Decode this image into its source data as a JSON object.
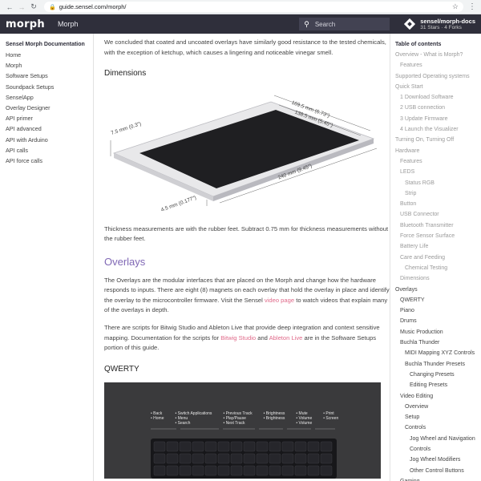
{
  "browser": {
    "back": "←",
    "forward": "→",
    "reload": "↻",
    "url": "guide.sensel.com/morph/",
    "star": "☆",
    "menu": "⋮"
  },
  "topnav": {
    "logo": "morph",
    "brand": "Morph",
    "search_placeholder": "Search",
    "repo_name": "sensel/morph-docs",
    "repo_stats": "31 Stars · 4 Forks"
  },
  "sidebar": {
    "title": "Sensel Morph Documentation",
    "items": [
      "Home",
      "Morph",
      "Software Setups",
      "Soundpack Setups",
      "SenselApp",
      "Overlay Designer",
      "API primer",
      "API advanced",
      "API with Arduino",
      "API calls",
      "API force calls"
    ]
  },
  "content": {
    "intro": "We concluded that coated and uncoated overlays have similarly good resistance to the tested chemicals, with the exception of ketchup, which causes a lingering and noticeable vinegar smell.",
    "dimensions_heading": "Dimensions",
    "dim_labels": {
      "width_outer": "169.5 mm (6.73\")",
      "width_inner": "138.5 mm (5.45\")",
      "height": "7.5 mm (0.3\")",
      "length": "240 mm (9.45\")",
      "thickness": "4.5 mm (0.177\")"
    },
    "thickness_note": "Thickness measurements are with the rubber feet. Subtract 0.75 mm for thickness measurements without the rubber feet.",
    "overlays_heading": "Overlays",
    "overlays_p1_a": "The Overlays are the modular interfaces that are placed on the Morph and change how the hardware responds to inputs. There are eight (8) magnets on each overlay that hold the overlay in place and identify the overlay to the microcontroller firmware. Visit the Sensel ",
    "overlays_p1_link": "video page",
    "overlays_p1_b": " to watch videos that explain many of the overlays in depth.",
    "overlays_p2_a": "There are scripts for Bitwig Studio and Ableton Live that provide deep integration and context sensitive mapping. Documentation for the scripts for ",
    "overlays_p2_link1": "Bitwig Studio",
    "overlays_p2_and": " and ",
    "overlays_p2_link2": "Ableton Live",
    "overlays_p2_b": " are in the Software Setups portion of this guide.",
    "qwerty_heading": "QWERTY",
    "kbd_groups": [
      [
        "Back",
        "Home"
      ],
      [
        "Switch Applications",
        "Menu",
        "Search"
      ],
      [
        "Previous Track",
        "Play/Pause",
        "Next Track"
      ],
      [
        "Brightness",
        "Brightness"
      ],
      [
        "Mute",
        "Volume",
        "Volume"
      ],
      [
        "Print",
        "Screen"
      ]
    ]
  },
  "toc": {
    "title": "Table of contents",
    "items": [
      {
        "label": "Overview - What is Morph?",
        "indent": 0
      },
      {
        "label": "Features",
        "indent": 1
      },
      {
        "label": "Supported Operating systems",
        "indent": 0
      },
      {
        "label": "Quick Start",
        "indent": 0
      },
      {
        "label": "1 Download Software",
        "indent": 1
      },
      {
        "label": "2 USB connection",
        "indent": 1
      },
      {
        "label": "3 Update Firmware",
        "indent": 1
      },
      {
        "label": "4 Launch the Visualizer",
        "indent": 1
      },
      {
        "label": "Turning On, Turning Off",
        "indent": 0
      },
      {
        "label": "Hardware",
        "indent": 0
      },
      {
        "label": "Features",
        "indent": 1
      },
      {
        "label": "LEDS",
        "indent": 1
      },
      {
        "label": "Status RGB",
        "indent": 2
      },
      {
        "label": "Strip",
        "indent": 2
      },
      {
        "label": "Button",
        "indent": 1
      },
      {
        "label": "USB Connector",
        "indent": 1
      },
      {
        "label": "Bluetooth Transmitter",
        "indent": 1
      },
      {
        "label": "Force Sensor Surface",
        "indent": 1
      },
      {
        "label": "Battery Life",
        "indent": 1
      },
      {
        "label": "Care and Feeding",
        "indent": 1
      },
      {
        "label": "Chemical Testing",
        "indent": 2
      },
      {
        "label": "Dimensions",
        "indent": 1
      },
      {
        "label": "Overlays",
        "indent": 0
      },
      {
        "label": "QWERTY",
        "indent": 1
      },
      {
        "label": "Piano",
        "indent": 1
      },
      {
        "label": "Drums",
        "indent": 1
      },
      {
        "label": "Music Production",
        "indent": 1
      },
      {
        "label": "Buchla Thunder",
        "indent": 1
      },
      {
        "label": "MIDI Mapping XYZ Controls",
        "indent": 2
      },
      {
        "label": "Buchla Thunder Presets",
        "indent": 2
      },
      {
        "label": "Changing Presets",
        "indent": 3
      },
      {
        "label": "Editing Presets",
        "indent": 3
      },
      {
        "label": "Video Editing",
        "indent": 1
      },
      {
        "label": "Overview",
        "indent": 2
      },
      {
        "label": "Setup",
        "indent": 2
      },
      {
        "label": "Controls",
        "indent": 2
      },
      {
        "label": "Jog Wheel and Navigation",
        "indent": 3
      },
      {
        "label": "Controls",
        "indent": 3
      },
      {
        "label": "Jog Wheel Modifiers",
        "indent": 3
      },
      {
        "label": "Other Control Buttons",
        "indent": 3
      },
      {
        "label": "Gaming",
        "indent": 1
      }
    ]
  }
}
